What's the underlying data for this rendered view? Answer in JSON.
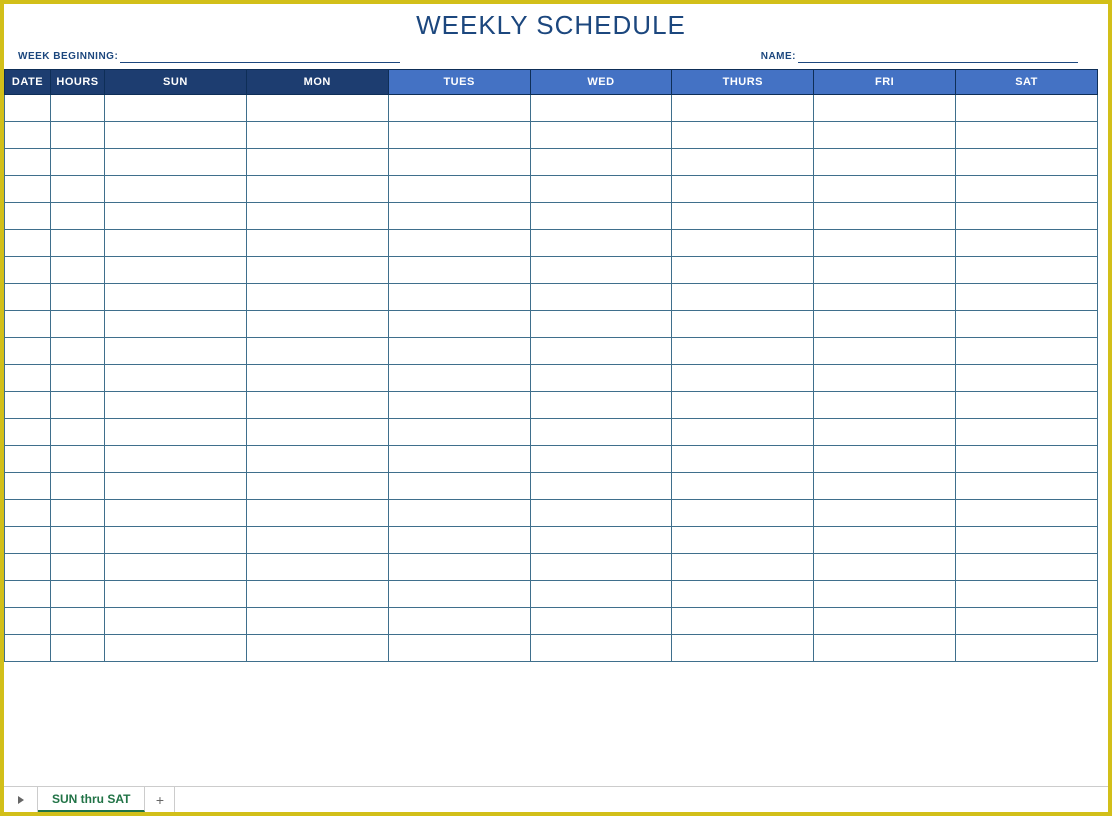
{
  "title": "WEEKLY SCHEDULE",
  "meta": {
    "week_label": "WEEK BEGINNING:",
    "week_value": "",
    "name_label": "NAME:",
    "name_value": ""
  },
  "columns": {
    "date": "DATE",
    "hours": "HOURS",
    "days": [
      "SUN",
      "MON",
      "TUES",
      "WED",
      "THURS",
      "FRI",
      "SAT"
    ]
  },
  "row_count": 21,
  "tabs": {
    "active": "SUN thru SAT"
  }
}
